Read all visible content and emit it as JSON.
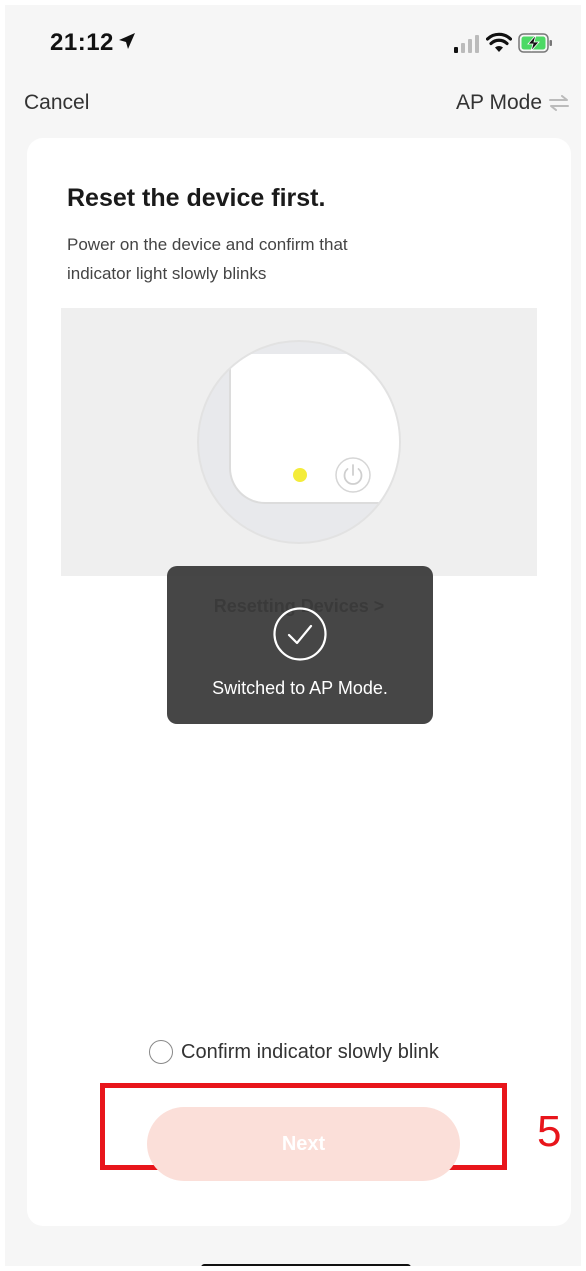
{
  "status_bar": {
    "time": "21:12",
    "icons": [
      "location-arrow-icon",
      "cellular-signal-icon",
      "wifi-icon",
      "battery-charging-icon"
    ],
    "battery_color": "#4cd964"
  },
  "nav": {
    "cancel_label": "Cancel",
    "mode_label": "AP Mode",
    "mode_icon": "switch-arrows-icon"
  },
  "card": {
    "title": "Reset the device first.",
    "description": "Power on the device and confirm that indicator light slowly blinks",
    "illustration": {
      "indicator_color": "#f4ec3a",
      "icons": [
        "power-icon"
      ]
    },
    "reset_link_label": "Resetting Devices >"
  },
  "toast": {
    "message": "Switched to AP Mode.",
    "icon": "check-circle-icon"
  },
  "confirm": {
    "label": "Confirm indicator slowly blink",
    "checked": false
  },
  "next_button": {
    "label": "Next",
    "enabled": false,
    "color": "#fbdfd9"
  },
  "annotation": {
    "step_number": "5",
    "color": "#e8151b"
  }
}
